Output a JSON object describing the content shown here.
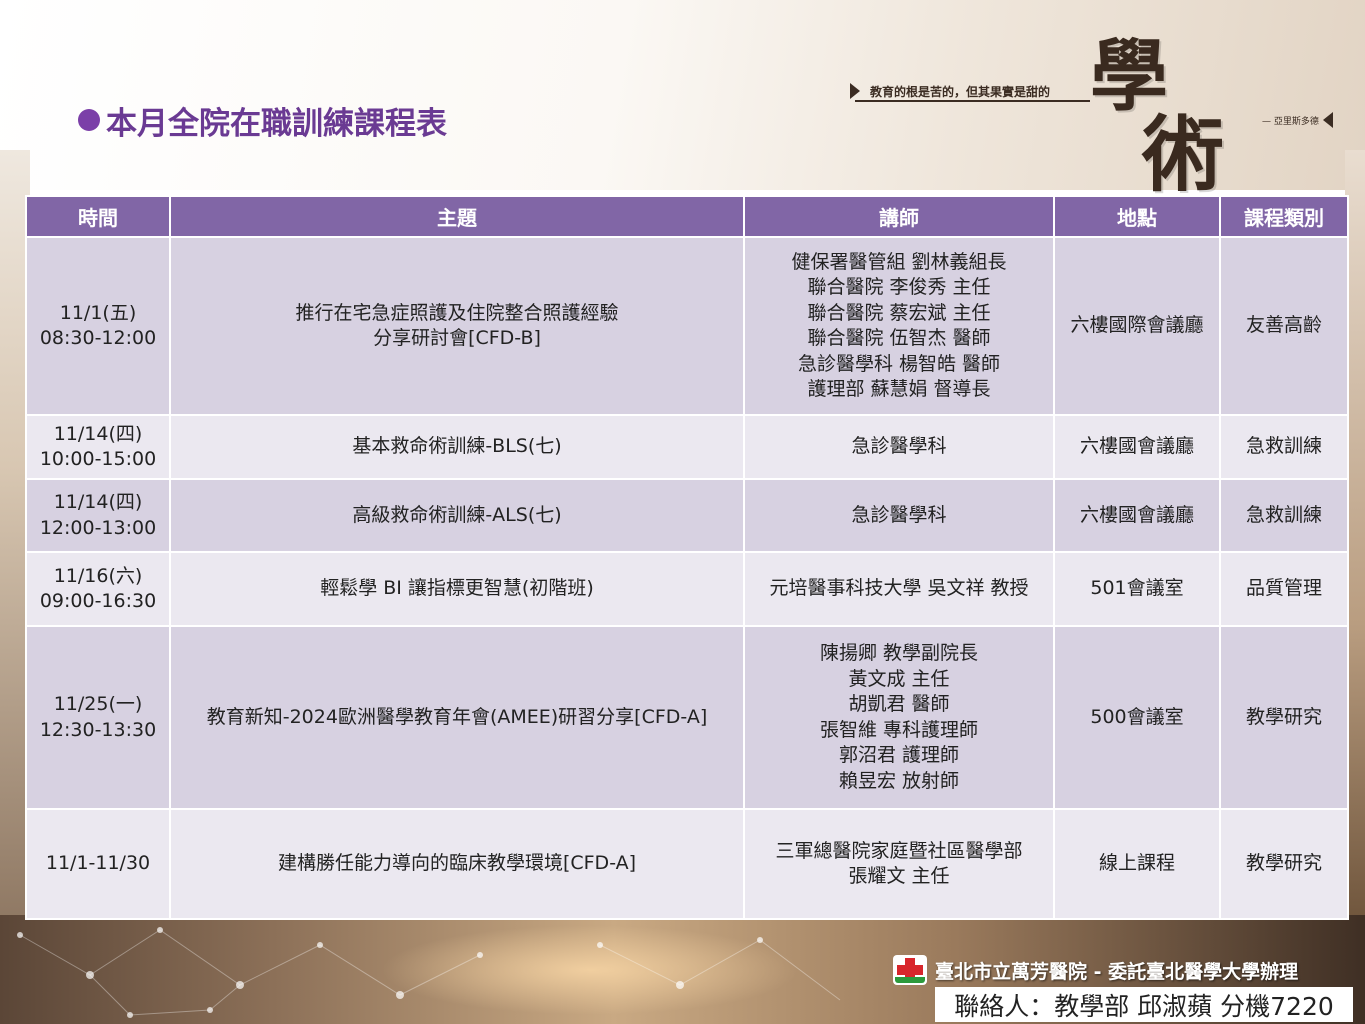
{
  "page": {
    "title": "本月全院在職訓練課程表",
    "motto": "教育的根是苦的，但其果實是甜的",
    "motto_author": "— 亞里斯多德",
    "logo_char_1": "學",
    "logo_char_2": "術"
  },
  "table": {
    "headers": [
      "時間",
      "主題",
      "講師",
      "地點",
      "課程類別"
    ],
    "rows": [
      {
        "time": [
          "11/1(五)",
          "08:30-12:00"
        ],
        "topic": [
          "推行在宅急症照護及住院整合照護經驗",
          "分享研討會[CFD-B]"
        ],
        "lecturer": [
          "健保署醫管組 劉林義組長",
          "聯合醫院 李俊秀 主任",
          "聯合醫院 蔡宏斌 主任",
          "聯合醫院 伍智杰 醫師",
          "急診醫學科 楊智皓 醫師",
          "護理部 蘇慧娟 督導長"
        ],
        "location": "六樓國際會議廳",
        "category": "友善高齡"
      },
      {
        "time": [
          "11/14(四)",
          "10:00-15:00"
        ],
        "topic": [
          "基本救命術訓練-BLS(七)"
        ],
        "lecturer": [
          "急診醫學科"
        ],
        "location": "六樓國會議廳",
        "category": "急救訓練"
      },
      {
        "time": [
          "11/14(四)",
          "12:00-13:00"
        ],
        "topic": [
          "高級救命術訓練-ALS(七)"
        ],
        "lecturer": [
          "急診醫學科"
        ],
        "location": "六樓國會議廳",
        "category": "急救訓練"
      },
      {
        "time": [
          "11/16(六)",
          "09:00-16:30"
        ],
        "topic": [
          "輕鬆學 BI 讓指標更智慧(初階班)"
        ],
        "lecturer": [
          "元培醫事科技大學 吳文祥 教授"
        ],
        "location": "501會議室",
        "category": "品質管理"
      },
      {
        "time": [
          "11/25(一)",
          "12:30-13:30"
        ],
        "topic": [
          "教育新知-2024歐洲醫學教育年會(AMEE)研習分享[CFD-A]"
        ],
        "lecturer": [
          "陳揚卿 教學副院長",
          "黃文成 主任",
          "胡凱君 醫師",
          "張智維 專科護理師",
          "郭沼君 護理師",
          "賴昱宏 放射師"
        ],
        "location": "500會議室",
        "category": "教學研究"
      },
      {
        "time": [
          "11/1-11/30"
        ],
        "topic": [
          "建構勝任能力導向的臨床教學環境[CFD-A]"
        ],
        "lecturer": [
          "三軍總醫院家庭暨社區醫學部",
          "張耀文 主任"
        ],
        "location": "線上課程",
        "category": "教學研究"
      }
    ]
  },
  "footer": {
    "hospital": "臺北市立萬芳醫院 - 委託臺北醫學大學辦理",
    "contact": "聯絡人：教學部 邱淑蘋 分機7220"
  },
  "colors": {
    "header_bg": "#8166a6",
    "row_dark": "#d7d1e1",
    "row_light": "#ebe8f0",
    "title": "#6a3a93"
  }
}
